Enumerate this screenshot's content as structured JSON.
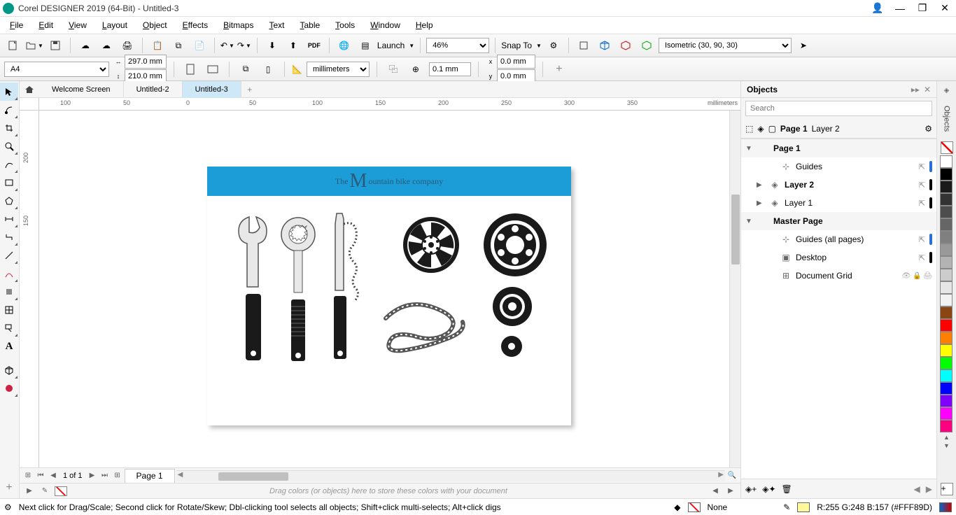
{
  "title": "Corel DESIGNER 2019 (64-Bit) - Untitled-3",
  "menus": [
    "File",
    "Edit",
    "View",
    "Layout",
    "Object",
    "Effects",
    "Bitmaps",
    "Text",
    "Table",
    "Tools",
    "Window",
    "Help"
  ],
  "toolbar1": {
    "launch": "Launch",
    "zoom": "46%",
    "snap": "Snap To",
    "projection": "Isometric (30, 90, 30)"
  },
  "toolbar2": {
    "page_size": "A4",
    "width": "297.0 mm",
    "height": "210.0 mm",
    "units": "millimeters",
    "nudge": "0.1 mm",
    "dup_x": "0.0 mm",
    "dup_y": "0.0 mm"
  },
  "tabs": {
    "items": [
      "Welcome Screen",
      "Untitled-2",
      "Untitled-3"
    ],
    "active": 2
  },
  "ruler_h": [
    "100",
    "50",
    "0",
    "50",
    "100",
    "150",
    "200",
    "250",
    "300",
    "350"
  ],
  "ruler_v": [
    "200",
    "150"
  ],
  "ruler_units": "millimeters",
  "canvas_doc": {
    "header": "The Mountain bike company"
  },
  "page_nav": {
    "info": "1 of 1",
    "page_tab": "Page 1"
  },
  "color_tray_hint": "Drag colors (or objects) here to store these colors with your document",
  "objects": {
    "title": "Objects",
    "search_placeholder": "Search",
    "breadcrumb_page": "Page 1",
    "breadcrumb_layer": "Layer 2",
    "tree": [
      {
        "type": "group",
        "label": "Page 1",
        "expanded": true
      },
      {
        "type": "item",
        "label": "Guides",
        "indent": 2,
        "icon": "guides",
        "color": "#2b6fd6"
      },
      {
        "type": "item",
        "label": "Layer 2",
        "indent": 1,
        "icon": "layer",
        "bold": true,
        "arrow": "▶",
        "color": "#000"
      },
      {
        "type": "item",
        "label": "Layer 1",
        "indent": 1,
        "icon": "layer",
        "arrow": "▶",
        "color": "#000"
      },
      {
        "type": "group",
        "label": "Master Page",
        "expanded": true
      },
      {
        "type": "item",
        "label": "Guides (all pages)",
        "indent": 2,
        "icon": "guides",
        "color": "#2b6fd6"
      },
      {
        "type": "item",
        "label": "Desktop",
        "indent": 2,
        "icon": "desktop",
        "color": "#000"
      },
      {
        "type": "item",
        "label": "Document Grid",
        "indent": 2,
        "icon": "grid"
      }
    ]
  },
  "palette": [
    "#ffffff",
    "#000000",
    "#1a1a1a",
    "#333333",
    "#4d4d4d",
    "#666666",
    "#808080",
    "#999999",
    "#b3b3b3",
    "#cccccc",
    "#e6e6e6",
    "#f2f2f2",
    "#8b4513",
    "#ff0000",
    "#ff8000",
    "#ffff00",
    "#00ff00",
    "#00ffff",
    "#0000ff",
    "#8000ff",
    "#ff00ff",
    "#ff0080"
  ],
  "status": {
    "msg": "Next click for Drag/Scale; Second click for Rotate/Skew; Dbl-clicking tool selects all objects; Shift+click multi-selects; Alt+click digs",
    "fill_none": "None",
    "color_info": "R:255 G:248 B:157 (#FFF89D)",
    "swatch": "#FFF89D"
  }
}
